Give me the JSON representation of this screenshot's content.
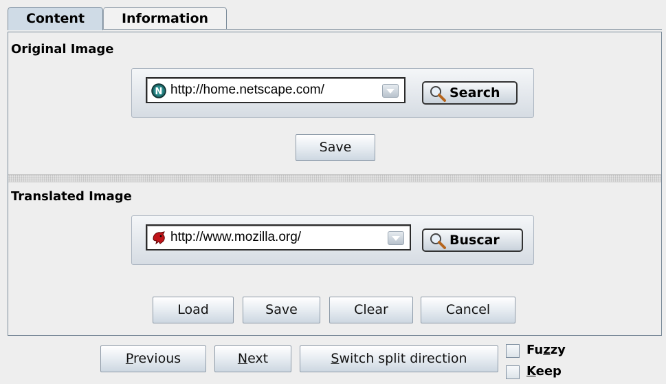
{
  "tabs": [
    {
      "label": "Content",
      "active": true
    },
    {
      "label": "Information",
      "active": false
    }
  ],
  "original": {
    "title": "Original Image",
    "url": "http://home.netscape.com/",
    "url_icon": "netscape-icon",
    "search_label": "Search",
    "save_label": "Save"
  },
  "translated": {
    "title": "Translated Image",
    "url": "http://www.mozilla.org/",
    "url_icon": "mozilla-icon",
    "search_label": "Buscar",
    "buttons": {
      "load": "Load",
      "save": "Save",
      "clear": "Clear",
      "cancel": "Cancel"
    }
  },
  "bottom": {
    "previous": {
      "mnemonic": "P",
      "rest": "revious"
    },
    "next": {
      "mnemonic": "N",
      "rest": "ext"
    },
    "switch": {
      "mnemonic": "S",
      "rest": "witch split direction"
    },
    "fuzzy": {
      "pre": "Fu",
      "mnemonic": "z",
      "post": "zy",
      "checked": false
    },
    "keep": {
      "mnemonic": "K",
      "rest": "eep",
      "checked": false
    }
  },
  "colors": {
    "tab_active": "#cfdbe6",
    "window_bg": "#eeeeee",
    "border": "#7a8a99"
  }
}
